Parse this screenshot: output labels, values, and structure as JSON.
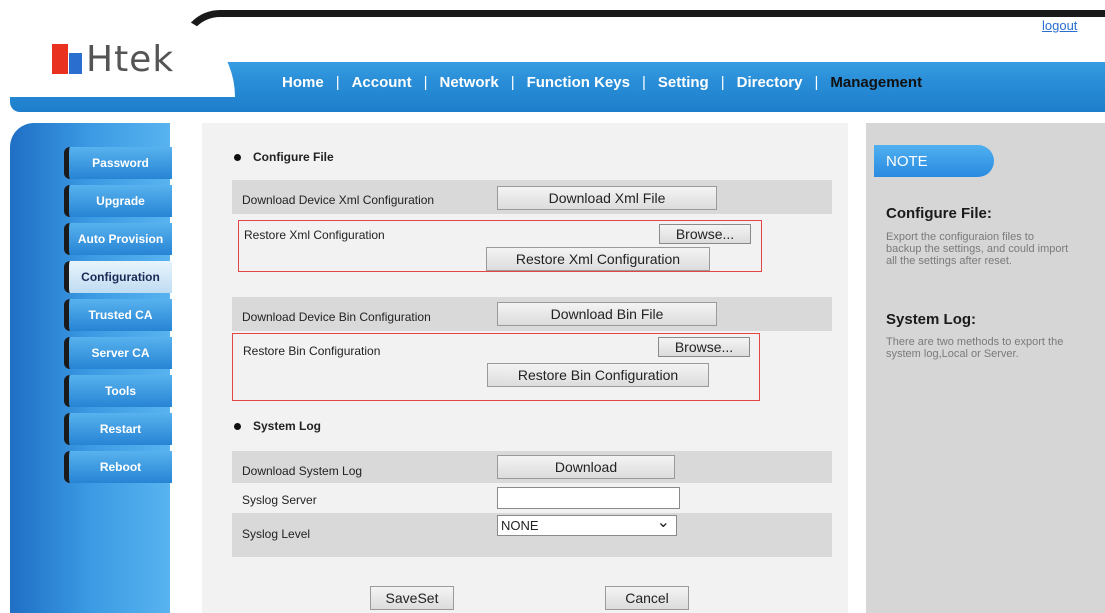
{
  "header": {
    "logo_text": "Htek",
    "logout": "logout",
    "nav": [
      {
        "label": "Home"
      },
      {
        "label": "Account"
      },
      {
        "label": "Network"
      },
      {
        "label": "Function Keys"
      },
      {
        "label": "Setting"
      },
      {
        "label": "Directory"
      },
      {
        "label": "Management",
        "active": true
      }
    ]
  },
  "sidebar": {
    "items": [
      {
        "label": "Password"
      },
      {
        "label": "Upgrade"
      },
      {
        "label": "Auto Provision"
      },
      {
        "label": "Configuration",
        "active": true
      },
      {
        "label": "Trusted CA"
      },
      {
        "label": "Server CA"
      },
      {
        "label": "Tools"
      },
      {
        "label": "Restart"
      },
      {
        "label": "Reboot"
      }
    ]
  },
  "main": {
    "configure_file": {
      "title": "Configure File",
      "download_xml_label": "Download Device Xml Configuration",
      "download_xml_button": "Download Xml File",
      "restore_xml_label": "Restore Xml Configuration",
      "browse_button": "Browse...",
      "restore_xml_button": "Restore Xml Configuration",
      "download_bin_label": "Download Device Bin Configuration",
      "download_bin_button": "Download Bin File",
      "restore_bin_label": "Restore Bin Configuration",
      "restore_bin_button": "Restore Bin Configuration"
    },
    "system_log": {
      "title": "System Log",
      "download_label": "Download System Log",
      "download_button": "Download",
      "server_label": "Syslog Server",
      "server_value": "",
      "level_label": "Syslog Level",
      "level_value": "NONE"
    },
    "saveset_button": "SaveSet",
    "cancel_button": "Cancel"
  },
  "note": {
    "badge": "NOTE",
    "sections": [
      {
        "title": "Configure File:",
        "lines": [
          "Export the configuraion files to",
          "backup the settings, and could import",
          "all the settings after reset."
        ]
      },
      {
        "title": "System Log:",
        "lines": [
          "There are two methods to export the",
          "system log,Local or Server."
        ]
      }
    ]
  },
  "colors": {
    "header_blue": "#2a8fd8",
    "sidebar_blue": "#3b9ae3",
    "highlight_red": "#e24545",
    "row_gray": "#d9d9d9"
  }
}
